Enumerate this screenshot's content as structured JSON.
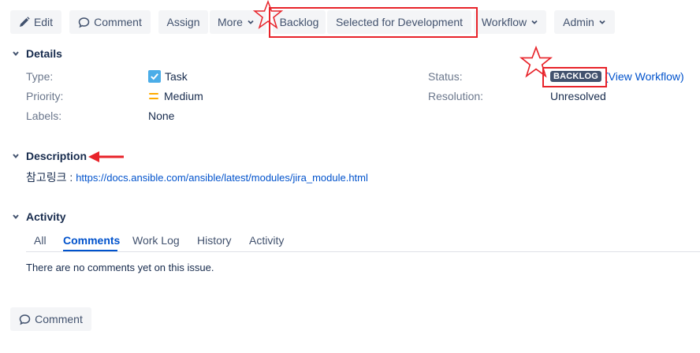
{
  "toolbar": {
    "edit": "Edit",
    "comment": "Comment",
    "assign": "Assign",
    "more": "More",
    "backlog": "Backlog",
    "selected_for_development": "Selected for Development",
    "workflow": "Workflow",
    "admin": "Admin"
  },
  "details": {
    "title": "Details",
    "type_label": "Type:",
    "type_value": "Task",
    "priority_label": "Priority:",
    "priority_value": "Medium",
    "labels_label": "Labels:",
    "labels_value": "None",
    "status_label": "Status:",
    "status_value": "BACKLOG",
    "view_workflow": "(View Workflow)",
    "resolution_label": "Resolution:",
    "resolution_value": "Unresolved"
  },
  "description": {
    "title": "Description",
    "prefix": "참고링크 : ",
    "link": "https://docs.ansible.com/ansible/latest/modules/jira_module.html"
  },
  "activity": {
    "title": "Activity",
    "tabs": [
      "All",
      "Comments",
      "Work Log",
      "History",
      "Activity"
    ],
    "active_tab": "Comments",
    "empty_message": "There are no comments yet on this issue."
  },
  "footer": {
    "comment_button": "Comment"
  },
  "colors": {
    "accent": "#0052cc",
    "annotation": "#e8232a",
    "task_icon": "#4bade8",
    "priority_medium": "#ffab00",
    "status_lozenge": "#42526e"
  }
}
